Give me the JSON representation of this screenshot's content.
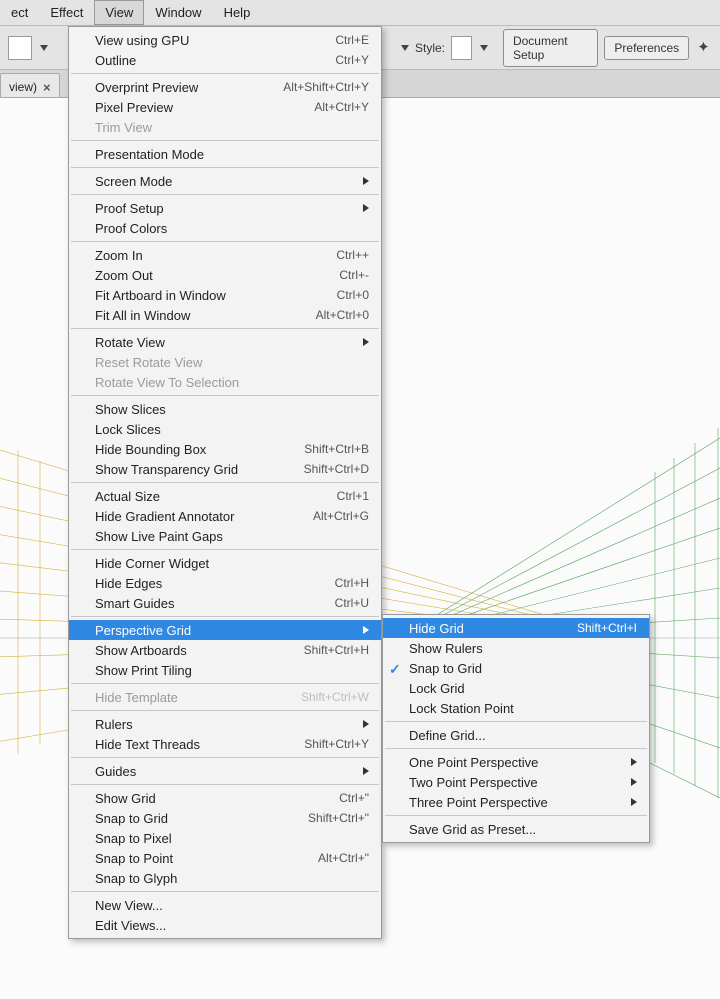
{
  "menubar": {
    "items": [
      "ect",
      "Effect",
      "View",
      "Window",
      "Help"
    ],
    "active_index": 2
  },
  "toolbar": {
    "style_label": "Style:",
    "doc_setup": "Document Setup",
    "prefs": "Preferences"
  },
  "tab": {
    "title": "view)",
    "close": "×"
  },
  "view_menu": [
    {
      "t": "item",
      "label": "View using GPU",
      "shortcut": "Ctrl+E"
    },
    {
      "t": "item",
      "label": "Outline",
      "shortcut": "Ctrl+Y"
    },
    {
      "t": "sep"
    },
    {
      "t": "item",
      "label": "Overprint Preview",
      "shortcut": "Alt+Shift+Ctrl+Y"
    },
    {
      "t": "item",
      "label": "Pixel Preview",
      "shortcut": "Alt+Ctrl+Y"
    },
    {
      "t": "item",
      "label": "Trim View",
      "disabled": true
    },
    {
      "t": "sep"
    },
    {
      "t": "item",
      "label": "Presentation Mode"
    },
    {
      "t": "sep"
    },
    {
      "t": "item",
      "label": "Screen Mode",
      "submenu": true
    },
    {
      "t": "sep"
    },
    {
      "t": "item",
      "label": "Proof Setup",
      "submenu": true
    },
    {
      "t": "item",
      "label": "Proof Colors"
    },
    {
      "t": "sep"
    },
    {
      "t": "item",
      "label": "Zoom In",
      "shortcut": "Ctrl++"
    },
    {
      "t": "item",
      "label": "Zoom Out",
      "shortcut": "Ctrl+-"
    },
    {
      "t": "item",
      "label": "Fit Artboard in Window",
      "shortcut": "Ctrl+0"
    },
    {
      "t": "item",
      "label": "Fit All in Window",
      "shortcut": "Alt+Ctrl+0"
    },
    {
      "t": "sep"
    },
    {
      "t": "item",
      "label": "Rotate View",
      "submenu": true
    },
    {
      "t": "item",
      "label": "Reset Rotate View",
      "disabled": true
    },
    {
      "t": "item",
      "label": "Rotate View To Selection",
      "disabled": true
    },
    {
      "t": "sep"
    },
    {
      "t": "item",
      "label": "Show Slices"
    },
    {
      "t": "item",
      "label": "Lock Slices"
    },
    {
      "t": "item",
      "label": "Hide Bounding Box",
      "shortcut": "Shift+Ctrl+B"
    },
    {
      "t": "item",
      "label": "Show Transparency Grid",
      "shortcut": "Shift+Ctrl+D"
    },
    {
      "t": "sep"
    },
    {
      "t": "item",
      "label": "Actual Size",
      "shortcut": "Ctrl+1"
    },
    {
      "t": "item",
      "label": "Hide Gradient Annotator",
      "shortcut": "Alt+Ctrl+G"
    },
    {
      "t": "item",
      "label": "Show Live Paint Gaps"
    },
    {
      "t": "sep"
    },
    {
      "t": "item",
      "label": "Hide Corner Widget"
    },
    {
      "t": "item",
      "label": "Hide Edges",
      "shortcut": "Ctrl+H"
    },
    {
      "t": "item",
      "label": "Smart Guides",
      "shortcut": "Ctrl+U"
    },
    {
      "t": "sep"
    },
    {
      "t": "item",
      "label": "Perspective Grid",
      "submenu": true,
      "highlight": true
    },
    {
      "t": "item",
      "label": "Show Artboards",
      "shortcut": "Shift+Ctrl+H"
    },
    {
      "t": "item",
      "label": "Show Print Tiling"
    },
    {
      "t": "sep"
    },
    {
      "t": "item",
      "label": "Hide Template",
      "shortcut": "Shift+Ctrl+W",
      "disabled": true
    },
    {
      "t": "sep"
    },
    {
      "t": "item",
      "label": "Rulers",
      "submenu": true
    },
    {
      "t": "item",
      "label": "Hide Text Threads",
      "shortcut": "Shift+Ctrl+Y"
    },
    {
      "t": "sep"
    },
    {
      "t": "item",
      "label": "Guides",
      "submenu": true
    },
    {
      "t": "sep"
    },
    {
      "t": "item",
      "label": "Show Grid",
      "shortcut": "Ctrl+\""
    },
    {
      "t": "item",
      "label": "Snap to Grid",
      "shortcut": "Shift+Ctrl+\""
    },
    {
      "t": "item",
      "label": "Snap to Pixel"
    },
    {
      "t": "item",
      "label": "Snap to Point",
      "shortcut": "Alt+Ctrl+\""
    },
    {
      "t": "item",
      "label": "Snap to Glyph"
    },
    {
      "t": "sep"
    },
    {
      "t": "item",
      "label": "New View..."
    },
    {
      "t": "item",
      "label": "Edit Views..."
    }
  ],
  "sub_menu": [
    {
      "t": "item",
      "label": "Hide Grid",
      "shortcut": "Shift+Ctrl+I",
      "highlight": true
    },
    {
      "t": "item",
      "label": "Show Rulers"
    },
    {
      "t": "item",
      "label": "Snap to Grid",
      "checked": true
    },
    {
      "t": "item",
      "label": "Lock Grid"
    },
    {
      "t": "item",
      "label": "Lock Station Point"
    },
    {
      "t": "sep"
    },
    {
      "t": "item",
      "label": "Define Grid..."
    },
    {
      "t": "sep"
    },
    {
      "t": "item",
      "label": "One Point Perspective",
      "submenu": true
    },
    {
      "t": "item",
      "label": "Two Point Perspective",
      "submenu": true
    },
    {
      "t": "item",
      "label": "Three Point Perspective",
      "submenu": true
    },
    {
      "t": "sep"
    },
    {
      "t": "item",
      "label": "Save Grid as Preset..."
    }
  ]
}
